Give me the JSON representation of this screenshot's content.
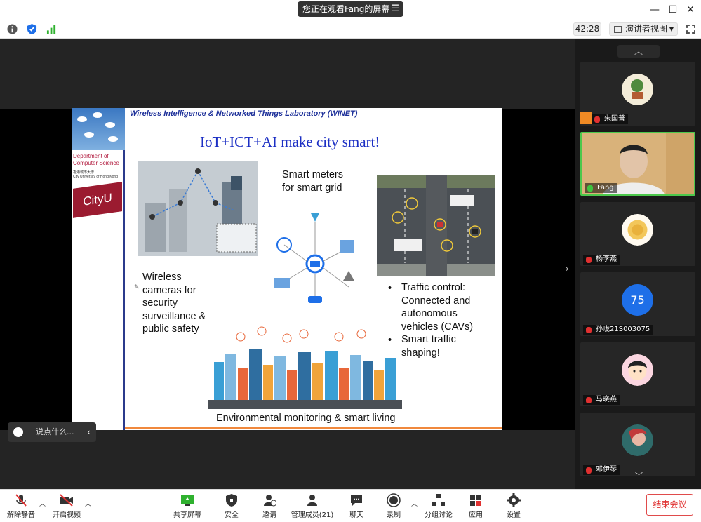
{
  "titlebar": {
    "viewing_label": "您正在观看Fang的屏幕",
    "menu_icon": "menu-icon",
    "min_icon": "minimize-icon",
    "max_icon": "maximize-icon",
    "close_icon": "close-icon"
  },
  "infobar": {
    "timer": "42:28",
    "view_mode": "演讲者视图",
    "icons": [
      "info-icon",
      "shield-icon",
      "signal-icon",
      "fullscreen-icon"
    ]
  },
  "slide": {
    "lab_name": "Wireless Intelligence & Networked Things Laboratory (WINET)",
    "title": "IoT+ICT+AI make city smart!",
    "dept_line1": "Department of",
    "dept_line2": "Computer Science",
    "university_cn": "香港城市大學",
    "university_en": "City University of Hong Kong",
    "logo": "CityU",
    "smart_meters": "Smart meters\nfor smart grid",
    "wireless_cameras": "Wireless\ncameras for\nsecurity\nsurveillance &\npublic safety",
    "traffic_1": "Traffic control:\nConnected and\nautonomous\nvehicles (CAVs)",
    "traffic_2": "Smart traffic\nshaping!",
    "bullet": "•",
    "environment": "Environmental monitoring & smart living"
  },
  "chat": {
    "placeholder": "说点什么...",
    "emoji_icon": "smile-icon",
    "collapse_icon": "chevron-left-icon"
  },
  "participants": [
    {
      "name": "朱国普",
      "type": "plant"
    },
    {
      "name": "Fang",
      "type": "video"
    },
    {
      "name": "杨李燕",
      "type": "rose"
    },
    {
      "name": "孙珑21S003075",
      "type": "number",
      "avatar_text": "75"
    },
    {
      "name": "马晓燕",
      "type": "cartoon"
    },
    {
      "name": "邓伊琴",
      "type": "art"
    }
  ],
  "toolbar": {
    "unmute": "解除静音",
    "start_video": "开启视频",
    "share_screen": "共享屏幕",
    "security": "安全",
    "invite": "邀请",
    "members": "管理成员(21)",
    "chat": "聊天",
    "record": "录制",
    "breakout": "分组讨论",
    "apps": "应用",
    "settings": "设置",
    "end_meeting": "结束会议"
  },
  "colors": {
    "accent_green": "#3ec43e",
    "end_red": "#e0302f",
    "slide_title_blue": "#1c2fc4"
  }
}
